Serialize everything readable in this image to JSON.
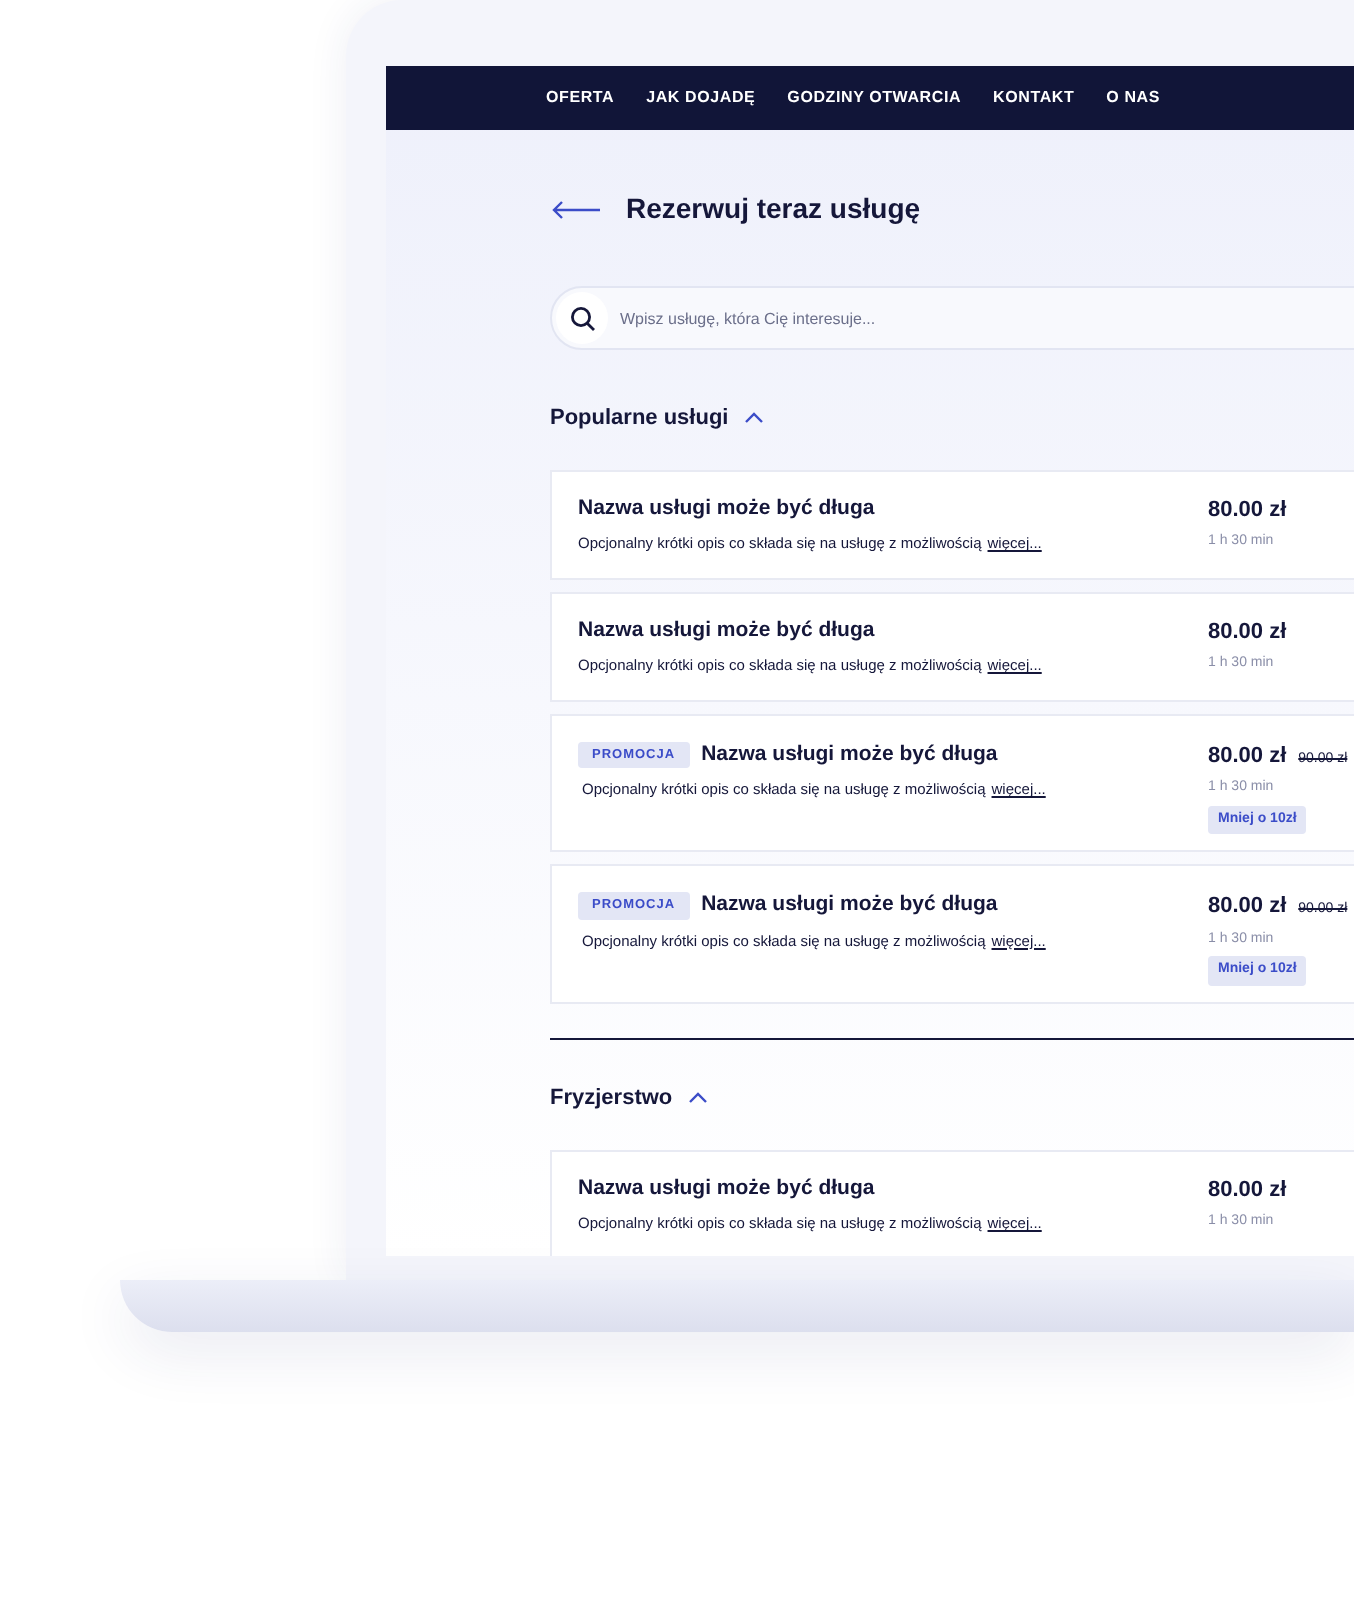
{
  "nav": [
    "OFERTA",
    "JAK DOJADĘ",
    "GODZINY OTWARCIA",
    "KONTAKT",
    "O NAS"
  ],
  "page_title": "Rezerwuj teraz usługę",
  "search": {
    "placeholder": "Wpisz usługę, która Cię interesuje..."
  },
  "sections": [
    {
      "title": "Popularne usługi",
      "expanded": true,
      "services": [
        {
          "name": "Nazwa usługi może być długa",
          "description": "Opcjonalny krótki opis co składa się na usługę z możliwością",
          "more": "więcej...",
          "price": "80.00 zł",
          "duration": "1 h 30 min"
        },
        {
          "name": "Nazwa usługi może być długa",
          "description": "Opcjonalny krótki opis co składa się na usługę z możliwością",
          "more": "więcej...",
          "price": "80.00 zł",
          "duration": "1 h 30 min"
        },
        {
          "badge": "PROMOCJA",
          "name": "Nazwa usługi może być długa",
          "description": "Opcjonalny krótki opis co składa się na usługę z możliwością",
          "more": "więcej...",
          "price": "80.00 zł",
          "old_price": "90.00 zł",
          "duration": "1 h 30 min",
          "discount": "Mniej o 10zł"
        },
        {
          "badge": "PROMOCJA",
          "name": "Nazwa usługi może być długa",
          "description": "Opcjonalny krótki opis co składa się na usługę z możliwością",
          "more": "więcej...",
          "price": "80.00 zł",
          "old_price": "90.00 zł",
          "duration": "1 h 30 min",
          "discount": "Mniej o 10zł"
        }
      ]
    },
    {
      "title": "Fryzjerstwo",
      "expanded": true,
      "services": [
        {
          "name": "Nazwa usługi może być długa",
          "description": "Opcjonalny krótki opis co składa się na usługę z możliwością",
          "more": "więcej...",
          "price": "80.00 zł",
          "duration": "1 h 30 min"
        }
      ]
    }
  ]
}
